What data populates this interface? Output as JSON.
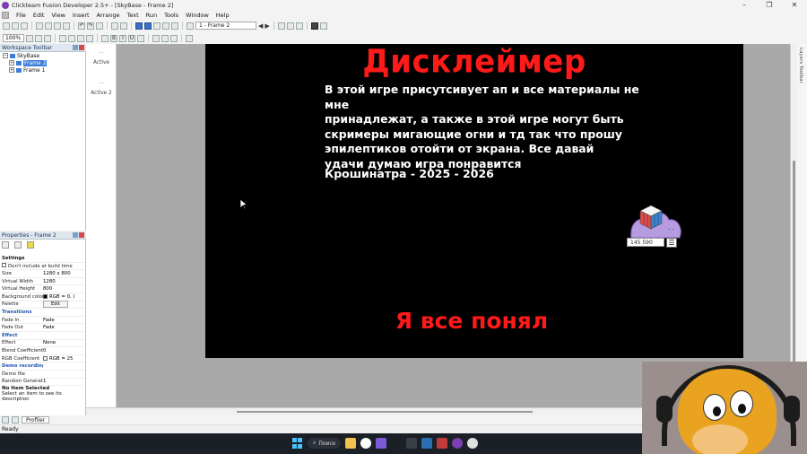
{
  "window": {
    "title": "Clickteam Fusion Developer 2.5+ - [SkyBase - Frame 2]",
    "controls": [
      "–",
      "❐",
      "✕"
    ]
  },
  "menu": [
    "File",
    "Edit",
    "View",
    "Insert",
    "Arrange",
    "Text",
    "Run",
    "Tools",
    "Window",
    "Help"
  ],
  "toolbar": {
    "frame_select": "1 - Frame 2",
    "zoom": "100%"
  },
  "workspace": {
    "title": "Workspace Toolbar",
    "tree": [
      {
        "label": "SkyBase",
        "level": 0
      },
      {
        "label": "Frame 2",
        "level": 1,
        "selected": true
      },
      {
        "label": "Frame 1",
        "level": 1
      }
    ]
  },
  "layers": {
    "items": [
      {
        "label": "Active",
        "dots": "..."
      },
      {
        "label": "Active 2",
        "dots": "..."
      }
    ]
  },
  "properties": {
    "title": "Properties - Frame 2",
    "rows": [
      {
        "key": "Settings",
        "value": "",
        "type": "cat"
      },
      {
        "key": "Don't include at build time",
        "value": "",
        "type": "check"
      },
      {
        "key": "Size",
        "value": "1280 x 800"
      },
      {
        "key": "Virtual Width",
        "value": "1280"
      },
      {
        "key": "Virtual Height",
        "value": "800"
      },
      {
        "key": "Background color",
        "value": "RGB = 0, (",
        "type": "color"
      },
      {
        "key": "Palette",
        "value": "Edit",
        "type": "button"
      },
      {
        "key": "Transitions",
        "value": "",
        "type": "cat-blue"
      },
      {
        "key": "Fade In",
        "value": "Fade"
      },
      {
        "key": "Fade Out",
        "value": "Fade"
      },
      {
        "key": "Effect",
        "value": "",
        "type": "cat-blue"
      },
      {
        "key": "Effect",
        "value": "None"
      },
      {
        "key": "Blend Coefficient",
        "value": "0"
      },
      {
        "key": "RGB Coefficient",
        "value": "RGB = 25",
        "type": "color-white"
      },
      {
        "key": "Demo recording",
        "value": "",
        "type": "cat-blue"
      },
      {
        "key": "Demo file",
        "value": ""
      },
      {
        "key": "Random Generator",
        "value": "1"
      }
    ],
    "no_item_title": "No Item Selected",
    "no_item_desc": "Select an item to see its description"
  },
  "bottom_tabs": [
    "Profiler"
  ],
  "game_frame": {
    "heading": "Дисклеймер",
    "body_lines": [
      "В этой игре присутсивует ап и все материалы не мне",
      "принадлежат, а также в этой игре могут быть",
      "скримеры мигающие огни и тд так что прошу",
      "эпилептиков отойти от экрана. Все давай",
      "удачи думаю игра понравится"
    ],
    "credit": "Крошинатра - 2025 - 2026",
    "confirm_button": "Я все понял",
    "heading_color": "#ff1a1a",
    "background": "#000000"
  },
  "widget": {
    "counter": "145 590",
    "menu_icon": "☰"
  },
  "right_sidebar": {
    "label": "Layers Toolbar"
  },
  "status": "Ready",
  "taskbar": {
    "search_label": "Поиск"
  }
}
